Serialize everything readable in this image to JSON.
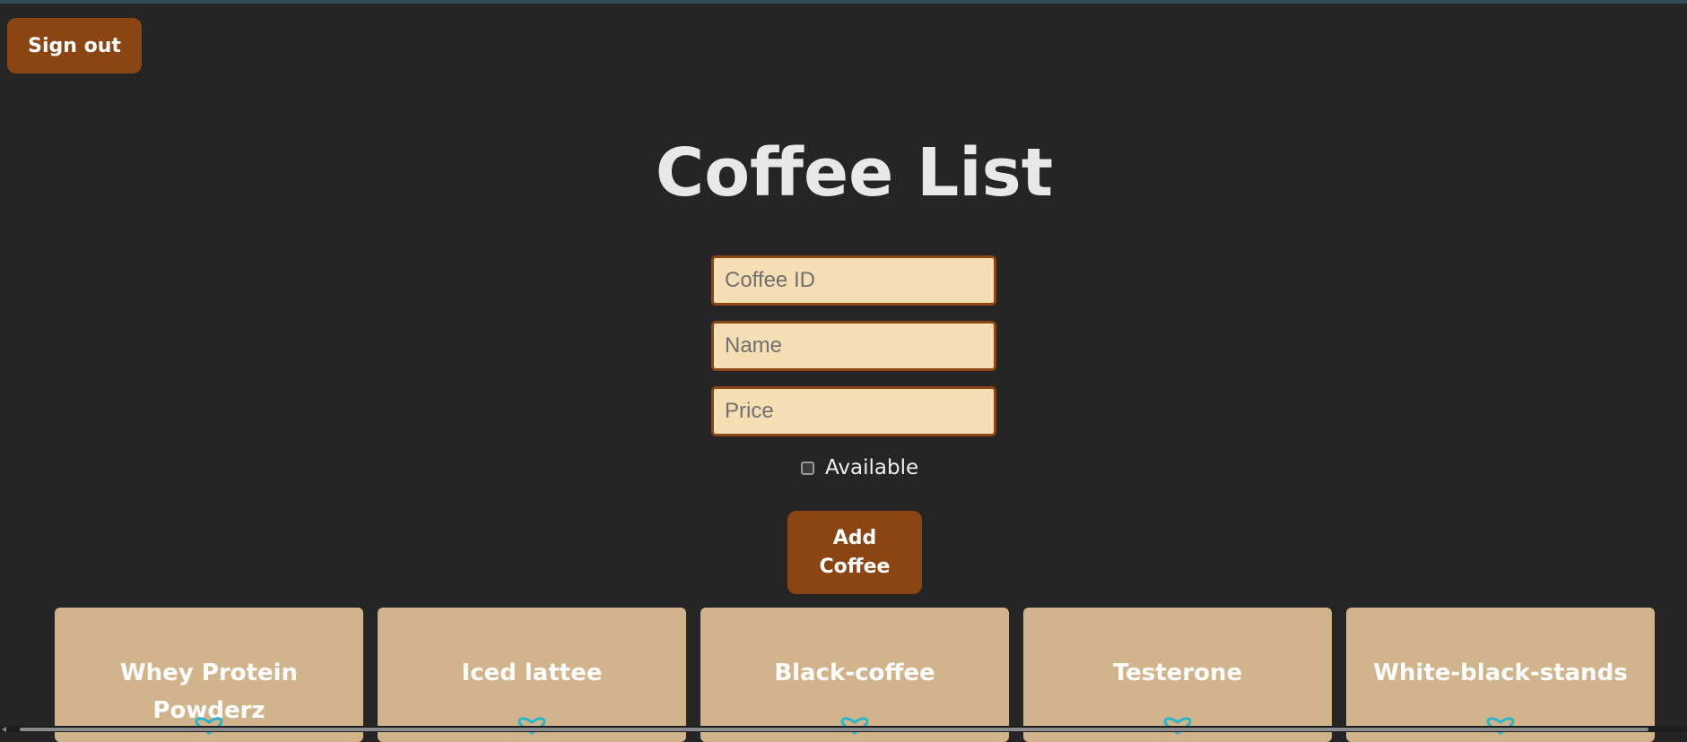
{
  "header": {
    "sign_out_label": "Sign out"
  },
  "page": {
    "title": "Coffee List"
  },
  "form": {
    "coffee_id_placeholder": "Coffee ID",
    "name_placeholder": "Name",
    "price_placeholder": "Price",
    "available_label": "Available",
    "available_checked": false,
    "add_button_label": "Add\nCoffee"
  },
  "coffees": [
    {
      "name": "Whey Protein Powderz",
      "icon": "heart-outline-icon"
    },
    {
      "name": "Iced lattee",
      "icon": "heart-outline-icon"
    },
    {
      "name": "Black-coffee",
      "icon": "heart-outline-icon"
    },
    {
      "name": "Testerone",
      "icon": "heart-outline-icon"
    },
    {
      "name": "White-black-stands",
      "icon": "heart-outline-icon"
    }
  ],
  "colors": {
    "background": "#252525",
    "accent": "#8b4513",
    "input_bg": "#f5deb3",
    "card_bg": "#d2b48c",
    "icon": "#29b6c9"
  }
}
